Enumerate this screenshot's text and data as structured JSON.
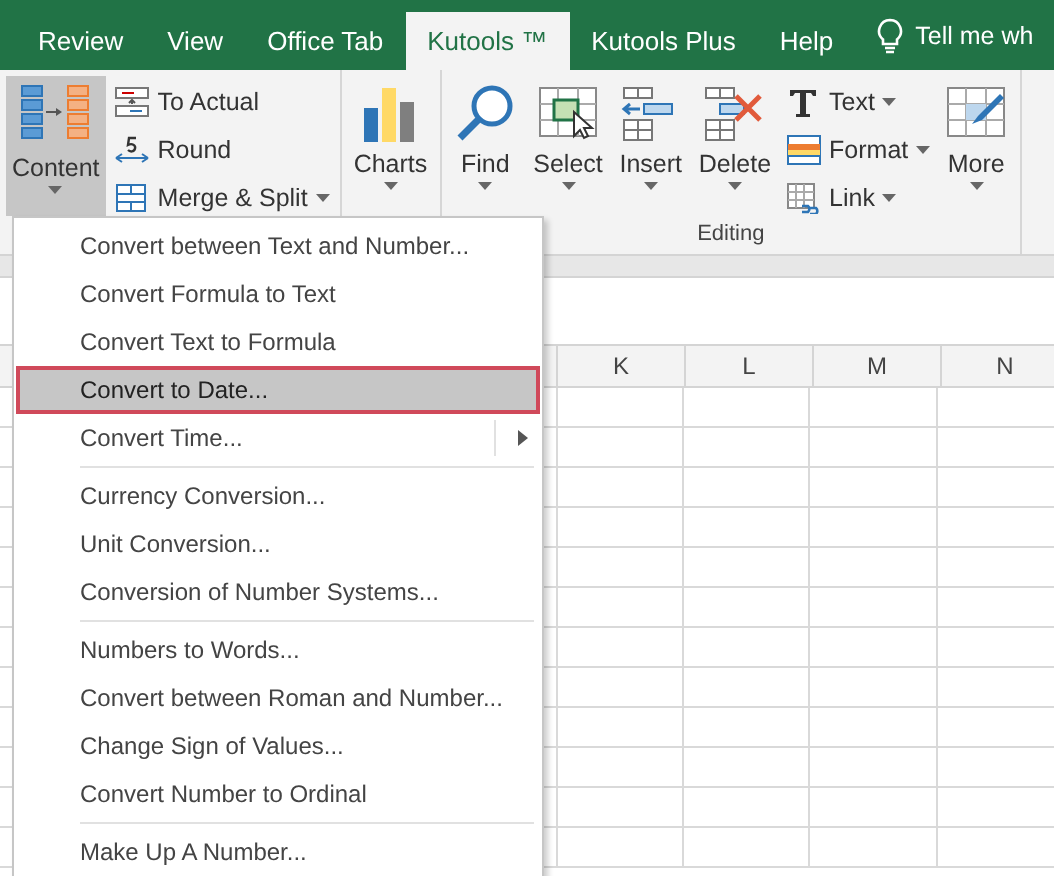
{
  "tabs": [
    {
      "label": "Review",
      "selected": false
    },
    {
      "label": "View",
      "selected": false
    },
    {
      "label": "Office Tab",
      "selected": false
    },
    {
      "label": "Kutools ™",
      "selected": true
    },
    {
      "label": "Kutools Plus",
      "selected": false
    },
    {
      "label": "Help",
      "selected": false
    }
  ],
  "tell_me": "Tell me wh",
  "ribbon": {
    "groups": [
      {
        "buttons": [
          {
            "kind": "large",
            "label": "Content",
            "dropdown": true,
            "pressed": true
          },
          {
            "kind": "stack",
            "items": [
              {
                "label": "To Actual",
                "dropdown": false
              },
              {
                "label": "Round",
                "dropdown": false
              },
              {
                "label": "Merge & Split",
                "dropdown": true
              }
            ]
          }
        ]
      },
      {
        "buttons": [
          {
            "kind": "large",
            "label": "Charts",
            "dropdown": true,
            "pressed": false
          }
        ]
      },
      {
        "label": "Editing",
        "buttons": [
          {
            "kind": "large",
            "label": "Find",
            "dropdown": true,
            "pressed": false
          },
          {
            "kind": "large",
            "label": "Select",
            "dropdown": true,
            "pressed": false
          },
          {
            "kind": "large",
            "label": "Insert",
            "dropdown": true,
            "pressed": false
          },
          {
            "kind": "large",
            "label": "Delete",
            "dropdown": true,
            "pressed": false
          },
          {
            "kind": "stack",
            "items": [
              {
                "label": "Text",
                "dropdown": true
              },
              {
                "label": "Format",
                "dropdown": true
              },
              {
                "label": "Link",
                "dropdown": true
              }
            ]
          },
          {
            "kind": "large",
            "label": "More",
            "dropdown": true,
            "pressed": false
          }
        ]
      }
    ]
  },
  "columns": [
    "K",
    "L",
    "M",
    "N"
  ],
  "menu": [
    {
      "kind": "item",
      "label": "Convert between Text and Number...",
      "selected": false,
      "submenu": false
    },
    {
      "kind": "item",
      "label": "Convert Formula to Text",
      "selected": false,
      "submenu": false
    },
    {
      "kind": "item",
      "label": "Convert Text to Formula",
      "selected": false,
      "submenu": false
    },
    {
      "kind": "item",
      "label": "Convert to Date...",
      "selected": true,
      "submenu": false
    },
    {
      "kind": "item",
      "label": "Convert Time...",
      "selected": false,
      "submenu": true
    },
    {
      "kind": "separator"
    },
    {
      "kind": "item",
      "label": "Currency Conversion...",
      "selected": false,
      "submenu": false
    },
    {
      "kind": "item",
      "label": "Unit Conversion...",
      "selected": false,
      "submenu": false
    },
    {
      "kind": "item",
      "label": "Conversion of Number Systems...",
      "selected": false,
      "submenu": false
    },
    {
      "kind": "separator"
    },
    {
      "kind": "item",
      "label": "Numbers to Words...",
      "selected": false,
      "submenu": false
    },
    {
      "kind": "item",
      "label": "Convert between Roman and Number...",
      "selected": false,
      "submenu": false
    },
    {
      "kind": "item",
      "label": "Change Sign of Values...",
      "selected": false,
      "submenu": false
    },
    {
      "kind": "item",
      "label": "Convert Number to Ordinal",
      "selected": false,
      "submenu": false
    },
    {
      "kind": "separator"
    },
    {
      "kind": "item",
      "label": "Make Up A Number...",
      "selected": false,
      "submenu": false
    }
  ]
}
